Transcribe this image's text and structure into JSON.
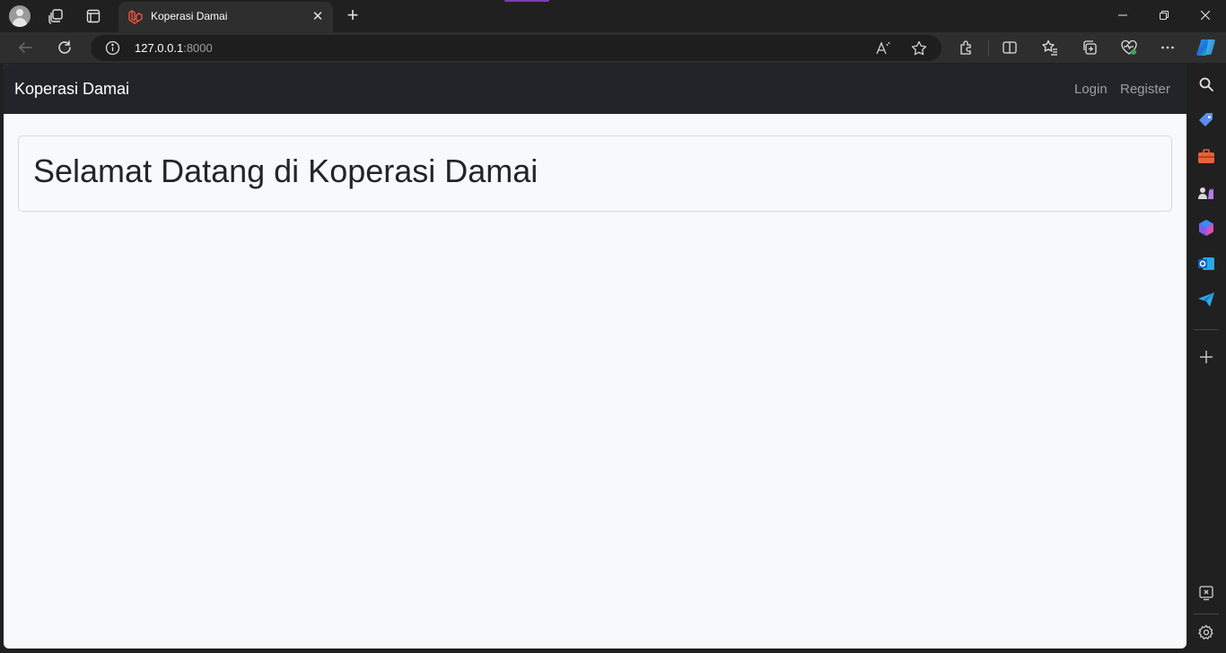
{
  "browser": {
    "tab": {
      "title": "Koperasi Damai"
    },
    "address": {
      "host": "127.0.0.1",
      "port": ":8000"
    }
  },
  "page": {
    "navbar": {
      "brand": "Koperasi Damai",
      "links": [
        "Login",
        "Register"
      ]
    },
    "card": {
      "heading": "Selamat Datang di Koperasi Damai"
    }
  },
  "colors": {
    "navbar_bg": "#212529",
    "page_bg": "#f8f9fa",
    "browser_chrome": "#202020",
    "laravel_red": "#f05340"
  },
  "icons": {
    "tabstrip": [
      "profile-avatar-icon",
      "workspaces-icon",
      "tab-actions-icon",
      "laravel-favicon-icon",
      "close-icon",
      "new-tab-icon"
    ],
    "toolbar": [
      "back-icon",
      "refresh-icon",
      "info-icon",
      "read-aloud-icon",
      "favorite-star-icon",
      "extensions-icon",
      "split-screen-icon",
      "favorites-icon",
      "collections-icon",
      "browser-essentials-icon",
      "more-icon",
      "copilot-icon"
    ],
    "sidebar": [
      "search-icon",
      "shopping-icon",
      "tools-icon",
      "games-icon",
      "office-icon",
      "outlook-icon",
      "send-icon",
      "add-icon",
      "screenshot-icon",
      "settings-icon"
    ]
  }
}
